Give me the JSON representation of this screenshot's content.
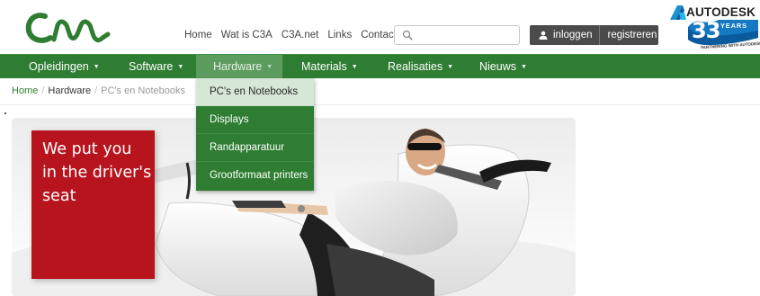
{
  "header": {
    "logo_alt": "C3A",
    "top_links": [
      "Home",
      "Wat is C3A",
      "C3A.net",
      "Links",
      "Contact"
    ],
    "search": {
      "value": "",
      "placeholder": ""
    },
    "login_label": "inloggen",
    "register_label": "registreren",
    "partner": {
      "brand": "AUTODESK",
      "years_number": "33",
      "years_label": "YEARS",
      "tagline": "PARTNERING WITH AUTODESK"
    }
  },
  "mainnav": {
    "items": [
      {
        "label": "Opleidingen"
      },
      {
        "label": "Software"
      },
      {
        "label": "Hardware"
      },
      {
        "label": "Materials"
      },
      {
        "label": "Realisaties"
      },
      {
        "label": "Nieuws"
      }
    ],
    "active": "Hardware"
  },
  "dropdown": {
    "items": [
      "PC's en Notebooks",
      "Displays",
      "Randapparatuur",
      "Grootformaat printers"
    ],
    "hovered": "PC's en Notebooks"
  },
  "breadcrumb": {
    "home": "Home",
    "section": "Hardware",
    "current": "PC's en Notebooks"
  },
  "banner": {
    "tagline_lines": [
      "We put you",
      "in the driver's",
      "seat"
    ]
  },
  "colors": {
    "nav_green": "#2e7d32",
    "banner_red": "#b8141e",
    "auth_bar": "#4b4b4b"
  }
}
